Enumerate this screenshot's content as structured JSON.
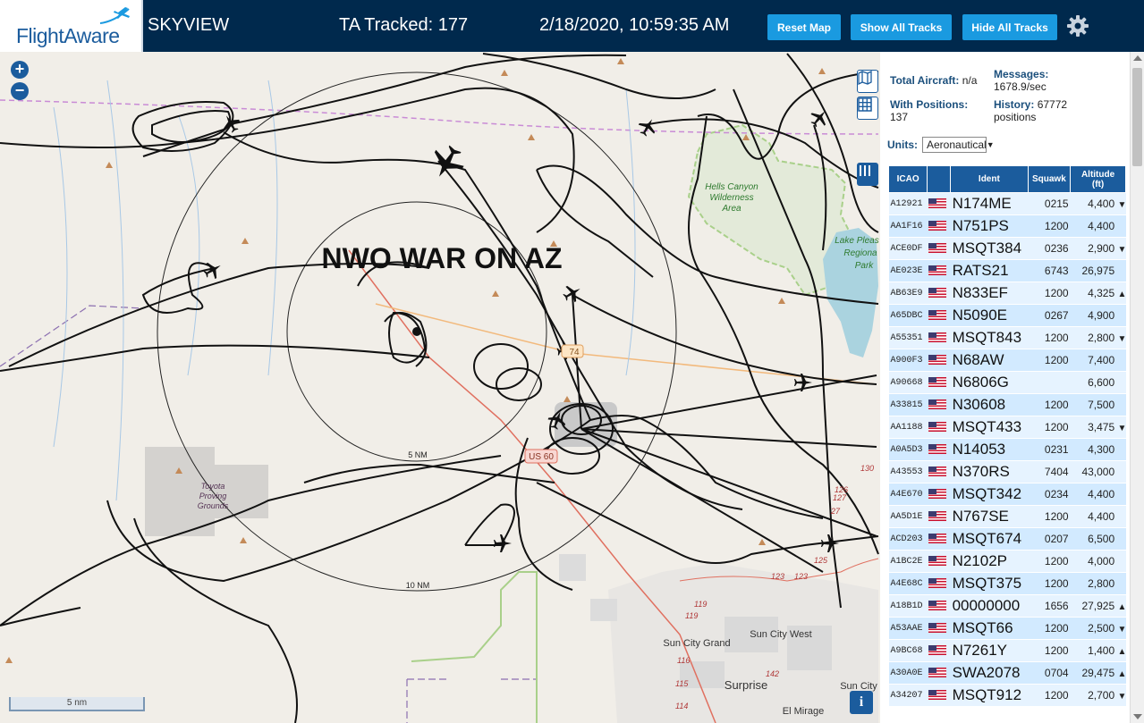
{
  "header": {
    "logo_text": "FlightAware",
    "title": "SKYVIEW",
    "tracked": "TA Tracked: 177",
    "datetime": "2/18/2020, 10:59:35 AM",
    "buttons": {
      "reset_map": "Reset Map",
      "show_all_tracks": "Show All Tracks",
      "hide_all_tracks": "Hide All Tracks"
    }
  },
  "map": {
    "overlay_title": "NWO WAR ON AZ",
    "range_5nm": "5 NM",
    "range_10nm": "10 NM",
    "route_label": "US 60",
    "route_label_2": "74",
    "area_hells_canyon": [
      "Hells Canyon",
      "Wilderness",
      "Area"
    ],
    "area_lake_pleasant": [
      "Lake Pleas",
      "Regiona",
      "Park"
    ],
    "area_proving": [
      "Toyota",
      "Proving",
      "Grounds"
    ],
    "cities": {
      "sun_city_grand": "Sun City Grand",
      "sun_city_west": "Sun City West",
      "surprise": "Surprise",
      "el_mirage": "El Mirage",
      "sun_city": "Sun City"
    },
    "road_numbers": [
      "119",
      "119",
      "116",
      "115",
      "114",
      "142",
      "123",
      "123",
      "125",
      "127",
      "27",
      "126",
      "130"
    ],
    "scale_label": "5 nm",
    "zoom_in": "+",
    "zoom_out": "−",
    "info": "i"
  },
  "sidebar": {
    "total_aircraft_label": "Total Aircraft:",
    "total_aircraft_value": "n/a",
    "messages_label": "Messages:",
    "messages_value": "1678.9/sec",
    "with_positions_label": "With Positions:",
    "with_positions_value": "137",
    "history_label": "History:",
    "history_value": "67772",
    "history_unit": "positions",
    "units_label": "Units:",
    "units_value": "Aeronautical",
    "columns": {
      "icao": "ICAO",
      "ident": "Ident",
      "squawk": "Squawk",
      "altitude": "Altitude",
      "altitude_unit": "(ft)"
    },
    "rows": [
      {
        "icao": "A12921",
        "ident": "N174ME",
        "squawk": "0215",
        "alt": "4,400",
        "trend": "▼"
      },
      {
        "icao": "AA1F16",
        "ident": "N751PS",
        "squawk": "1200",
        "alt": "4,400",
        "trend": ""
      },
      {
        "icao": "ACE0DF",
        "ident": "MSQT384",
        "squawk": "0236",
        "alt": "2,900",
        "trend": "▼"
      },
      {
        "icao": "AE023E",
        "ident": "RATS21",
        "squawk": "6743",
        "alt": "26,975",
        "trend": ""
      },
      {
        "icao": "AB63E9",
        "ident": "N833EF",
        "squawk": "1200",
        "alt": "4,325",
        "trend": "▲"
      },
      {
        "icao": "A65DBC",
        "ident": "N5090E",
        "squawk": "0267",
        "alt": "4,900",
        "trend": ""
      },
      {
        "icao": "A55351",
        "ident": "MSQT843",
        "squawk": "1200",
        "alt": "2,800",
        "trend": "▼"
      },
      {
        "icao": "A900F3",
        "ident": "N68AW",
        "squawk": "1200",
        "alt": "7,400",
        "trend": ""
      },
      {
        "icao": "A90668",
        "ident": "N6806G",
        "squawk": "",
        "alt": "6,600",
        "trend": ""
      },
      {
        "icao": "A33815",
        "ident": "N30608",
        "squawk": "1200",
        "alt": "7,500",
        "trend": ""
      },
      {
        "icao": "AA1188",
        "ident": "MSQT433",
        "squawk": "1200",
        "alt": "3,475",
        "trend": "▼"
      },
      {
        "icao": "A0A5D3",
        "ident": "N14053",
        "squawk": "0231",
        "alt": "4,300",
        "trend": ""
      },
      {
        "icao": "A43553",
        "ident": "N370RS",
        "squawk": "7404",
        "alt": "43,000",
        "trend": ""
      },
      {
        "icao": "A4E670",
        "ident": "MSQT342",
        "squawk": "0234",
        "alt": "4,400",
        "trend": ""
      },
      {
        "icao": "AA5D1E",
        "ident": "N767SE",
        "squawk": "1200",
        "alt": "4,400",
        "trend": ""
      },
      {
        "icao": "ACD203",
        "ident": "MSQT674",
        "squawk": "0207",
        "alt": "6,500",
        "trend": ""
      },
      {
        "icao": "A1BC2E",
        "ident": "N2102P",
        "squawk": "1200",
        "alt": "4,000",
        "trend": ""
      },
      {
        "icao": "A4E68C",
        "ident": "MSQT375",
        "squawk": "1200",
        "alt": "2,800",
        "trend": ""
      },
      {
        "icao": "A18B1D",
        "ident": "00000000",
        "squawk": "1656",
        "alt": "27,925",
        "trend": "▲"
      },
      {
        "icao": "A53AAE",
        "ident": "MSQT66",
        "squawk": "1200",
        "alt": "2,500",
        "trend": "▼"
      },
      {
        "icao": "A9BC68",
        "ident": "N7261Y",
        "squawk": "1200",
        "alt": "1,400",
        "trend": "▲"
      },
      {
        "icao": "A30A0E",
        "ident": "SWA2078",
        "squawk": "0704",
        "alt": "29,475",
        "trend": "▲"
      },
      {
        "icao": "A34207",
        "ident": "MSQT912",
        "squawk": "1200",
        "alt": "2,700",
        "trend": "▼"
      }
    ]
  }
}
